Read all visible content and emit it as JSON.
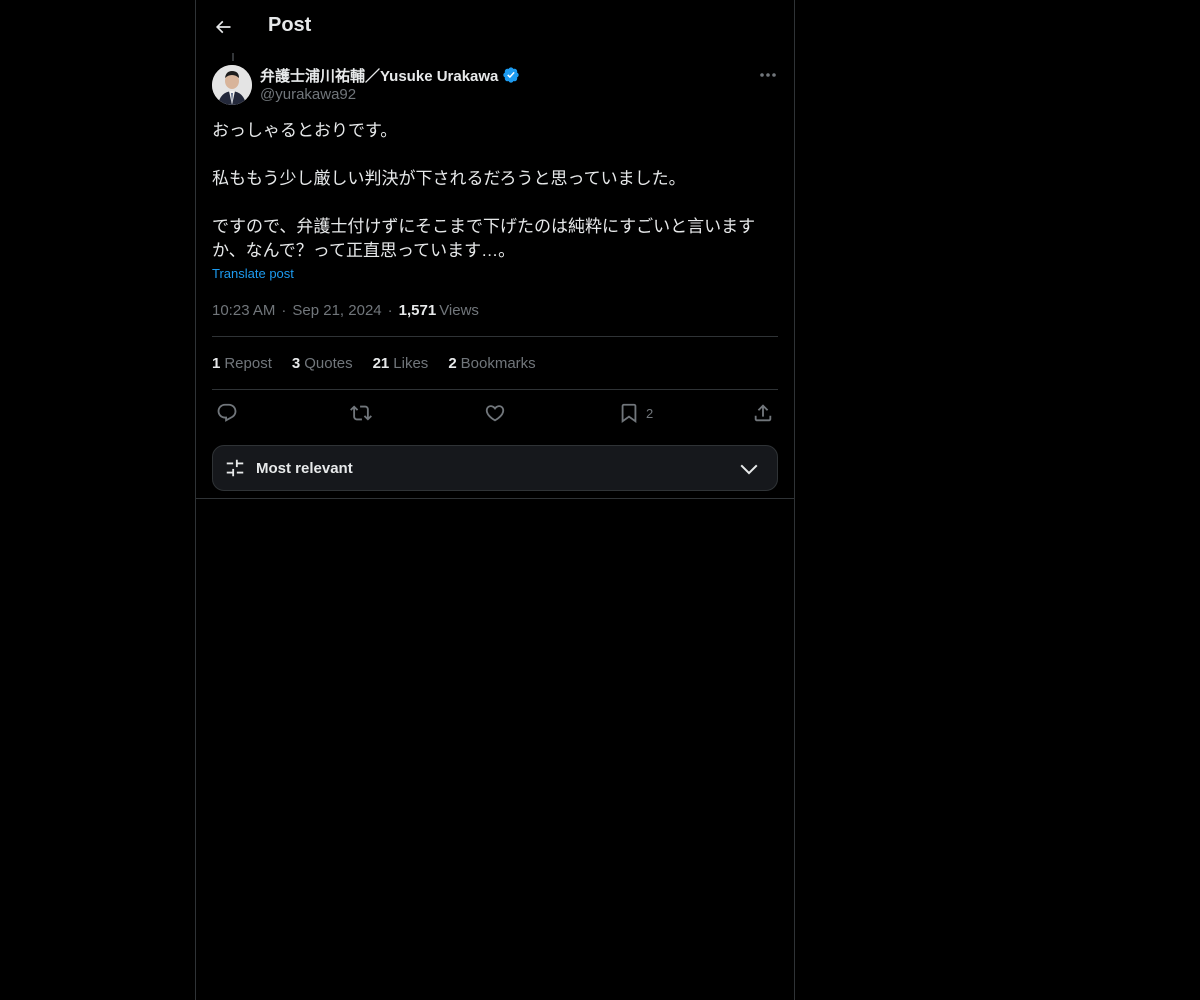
{
  "header": {
    "title": "Post",
    "back_icon": "arrow-left-icon"
  },
  "post": {
    "author_name": "弁護士浦川祐輔／Yusuke Urakawa",
    "verified": true,
    "handle": "@yurakawa92",
    "body": {
      "line1": "おっしゃるとおりです。",
      "line2": "私ももう少し厳しい判決が下されるだろうと思っていました。",
      "line3a": "ですので、弁護士付けずにそこまで下げたのは純粋にすごいと言います",
      "line3b": "か、なんで？って正直思っています…。"
    },
    "translate_label": "Translate post",
    "time": "10:23 AM",
    "date": "Sep 21, 2024",
    "views_count": "1,571",
    "views_label": "Views"
  },
  "stats": {
    "reposts": {
      "count": "1",
      "label": "Repost"
    },
    "quotes": {
      "count": "3",
      "label": "Quotes"
    },
    "likes": {
      "count": "21",
      "label": "Likes"
    },
    "bookmarks": {
      "count": "2",
      "label": "Bookmarks"
    }
  },
  "actions": {
    "reply_icon": "reply-icon",
    "repost_icon": "repost-icon",
    "like_icon": "heart-icon",
    "bookmark_icon": "bookmark-icon",
    "bookmark_count": "2",
    "share_icon": "share-icon"
  },
  "sort": {
    "label": "Most relevant",
    "icon": "sliders-icon",
    "chevron": "chevron-down-icon"
  },
  "colors": {
    "background": "#000000",
    "text_primary": "#e7e9ea",
    "text_secondary": "#71767b",
    "accent": "#1d9bf0",
    "border": "#2f3336"
  }
}
